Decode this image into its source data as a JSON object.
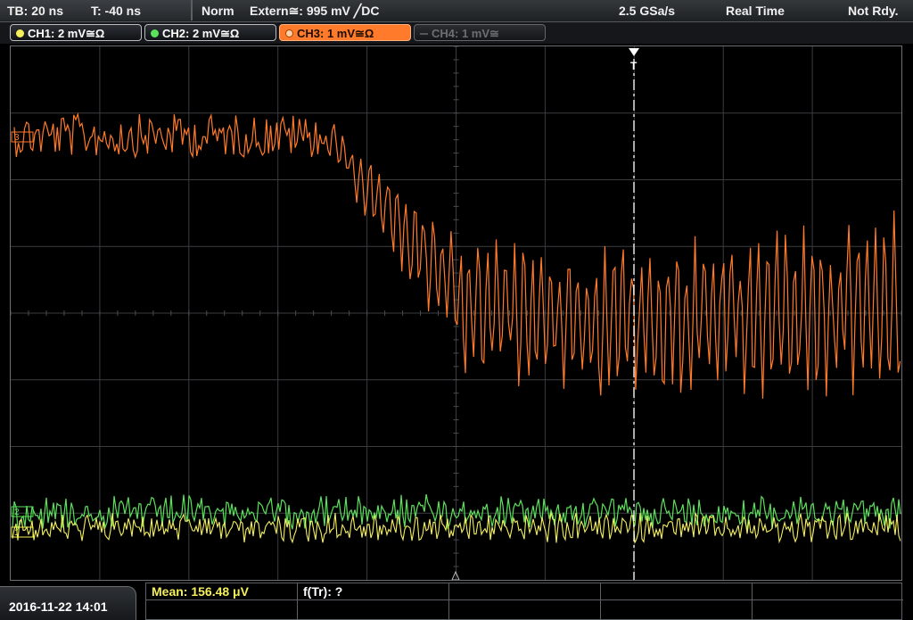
{
  "topbar": {
    "timebase": "TB: 20 ns",
    "trigger_pos": "T: -40 ns",
    "mode": "Norm",
    "source": "Extern≅: 995 mV ╱DC",
    "sample_rate": "2.5 GSa/s",
    "acq": "Real Time",
    "status": "Not Rdy."
  },
  "channels": [
    {
      "label": "CH1: 2 mV≅Ω",
      "color": "#f5f05a",
      "state": "normal"
    },
    {
      "label": "CH2: 2 mV≅Ω",
      "color": "#5ae25a",
      "state": "normal"
    },
    {
      "label": "CH3: 1 mV≅Ω",
      "color": "#ff7a2a",
      "state": "active"
    },
    {
      "label": "CH4: 1 mV≅",
      "color": "#6b6e72",
      "state": "off"
    }
  ],
  "markers": {
    "trigger_label": "T",
    "ch3_marker": "3",
    "ch2_marker": "2",
    "ch1_marker": "1"
  },
  "bottom": {
    "datetime": "2016-11-22 14:01",
    "meas1": "Mean: 156.48 μV",
    "meas2": "f(Tr): ?"
  },
  "colors": {
    "ch1": "#f5f05a",
    "ch2": "#5ae25a",
    "ch3": "#ff7a2a",
    "grid": "#3a3d40"
  }
}
